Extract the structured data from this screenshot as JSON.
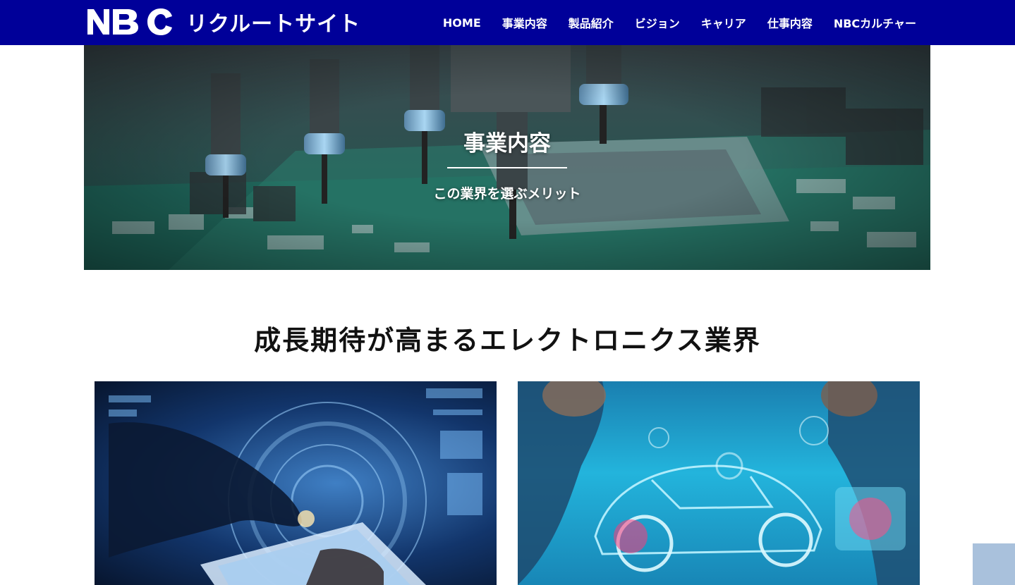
{
  "header": {
    "logo_letters": "NBC",
    "site_name": "リクルートサイト",
    "nav": [
      {
        "label": "HOME"
      },
      {
        "label": "事業内容"
      },
      {
        "label": "製品紹介"
      },
      {
        "label": "ビジョン"
      },
      {
        "label": "キャリア"
      },
      {
        "label": "仕事内容"
      },
      {
        "label": "NBCカルチャー"
      }
    ],
    "background_color": "#000099"
  },
  "hero": {
    "title": "事業内容",
    "subtitle": "この業界を選ぶメリット",
    "image": "circuit-board-pick-and-place-photo"
  },
  "section": {
    "heading": "成長期待が高まるエレクトロニクス業界",
    "cards": [
      {
        "image": "digital-tablet-technology-photo"
      },
      {
        "image": "holographic-car-engineers-photo"
      }
    ]
  },
  "scroll_top": {
    "icon": "arrow-up-icon",
    "glyph": "",
    "background_color": "#a9c1dc"
  }
}
